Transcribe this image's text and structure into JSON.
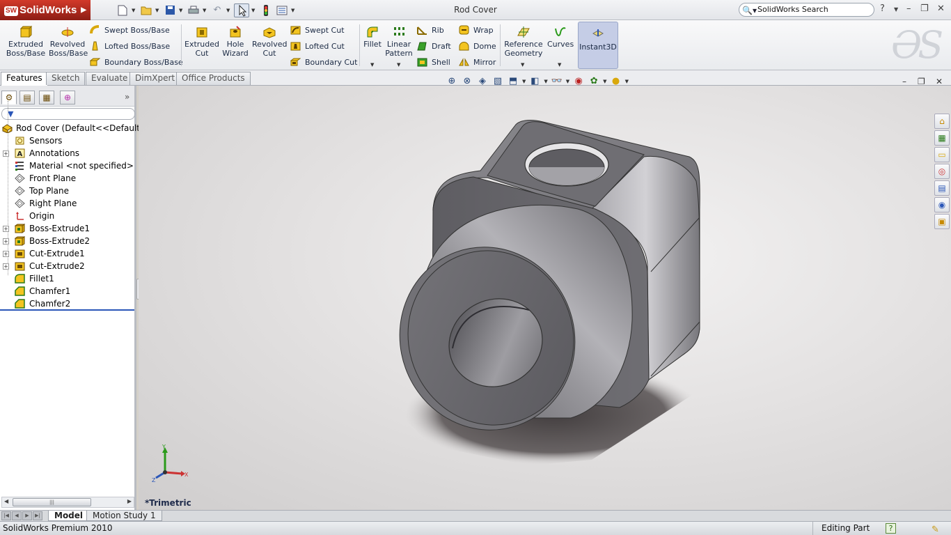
{
  "app": {
    "logo": "SolidWorks",
    "window_title": "Rod Cover",
    "search_placeholder": "SolidWorks Search",
    "help": "?"
  },
  "toolbar": {
    "extruded_boss": "Extruded Boss/Base",
    "revolved_boss": "Revolved Boss/Base",
    "swept_boss": "Swept Boss/Base",
    "lofted_boss": "Lofted Boss/Base",
    "boundary_boss": "Boundary Boss/Base",
    "extruded_cut": "Extruded Cut",
    "hole_wizard": "Hole Wizard",
    "revolved_cut": "Revolved Cut",
    "swept_cut": "Swept Cut",
    "lofted_cut": "Lofted Cut",
    "boundary_cut": "Boundary Cut",
    "fillet": "Fillet",
    "linear_pattern": "Linear Pattern",
    "rib": "Rib",
    "draft": "Draft",
    "shell": "Shell",
    "wrap": "Wrap",
    "dome": "Dome",
    "mirror": "Mirror",
    "reference_geometry": "Reference Geometry",
    "curves": "Curves",
    "instant3d": "Instant3D"
  },
  "tabs": [
    "Features",
    "Sketch",
    "Evaluate",
    "DimXpert",
    "Office Products"
  ],
  "active_tab": "Features",
  "tree": {
    "root": "Rod Cover  (Default<<Default>_",
    "items": [
      {
        "label": "Sensors",
        "icon": "sensor-icon",
        "expandable": false
      },
      {
        "label": "Annotations",
        "icon": "annotation-icon",
        "expandable": true
      },
      {
        "label": "Material <not specified>",
        "icon": "material-icon",
        "expandable": false
      },
      {
        "label": "Front Plane",
        "icon": "plane-icon",
        "expandable": false
      },
      {
        "label": "Top Plane",
        "icon": "plane-icon",
        "expandable": false
      },
      {
        "label": "Right Plane",
        "icon": "plane-icon",
        "expandable": false
      },
      {
        "label": "Origin",
        "icon": "origin-icon",
        "expandable": false
      },
      {
        "label": "Boss-Extrude1",
        "icon": "boss-extrude-icon",
        "expandable": true
      },
      {
        "label": "Boss-Extrude2",
        "icon": "boss-extrude-icon",
        "expandable": true
      },
      {
        "label": "Cut-Extrude1",
        "icon": "cut-extrude-icon",
        "expandable": true
      },
      {
        "label": "Cut-Extrude2",
        "icon": "cut-extrude-icon",
        "expandable": true
      },
      {
        "label": "Fillet1",
        "icon": "fillet-icon",
        "expandable": false
      },
      {
        "label": "Chamfer1",
        "icon": "chamfer-icon",
        "expandable": false
      },
      {
        "label": "Chamfer2",
        "icon": "chamfer-icon",
        "expandable": false
      }
    ]
  },
  "viewport": {
    "view_name": "*Trimetric",
    "axis_labels": {
      "x": "X",
      "y": "Y",
      "z": "Z"
    }
  },
  "bottom_tabs": [
    "Model",
    "Motion Study 1"
  ],
  "active_bottom_tab": "Model",
  "status": {
    "left": "SolidWorks Premium 2010",
    "mode": "Editing Part"
  },
  "colors": {
    "logo_red": "#c1271b",
    "accent_blue": "#2a56b8",
    "part_gray": "#6b6a70"
  }
}
